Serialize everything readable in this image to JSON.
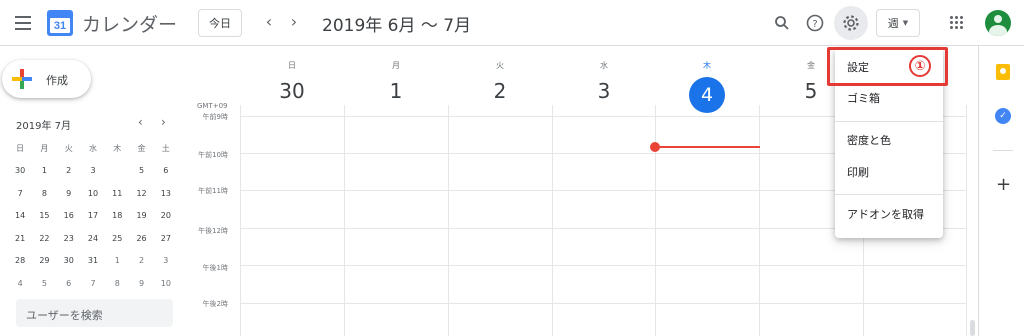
{
  "header": {
    "app_title": "カレンダー",
    "logo_day": "31",
    "today_button": "今日",
    "prev": "‹",
    "next": "›",
    "date_range": "2019年 6月 〜 7月",
    "view_select": "週",
    "icons": [
      "menu-icon",
      "search-icon",
      "help-icon",
      "settings-icon",
      "apps-icon",
      "account-icon"
    ]
  },
  "sidebar": {
    "create_label": "作成",
    "mini_calendar": {
      "title": "2019年 7月",
      "weekdays": [
        "日",
        "月",
        "火",
        "水",
        "木",
        "金",
        "土"
      ],
      "weeks": [
        [
          "30",
          "1",
          "2",
          "3",
          "4",
          "5",
          "6"
        ],
        [
          "7",
          "8",
          "9",
          "10",
          "11",
          "12",
          "13"
        ],
        [
          "14",
          "15",
          "16",
          "17",
          "18",
          "19",
          "20"
        ],
        [
          "21",
          "22",
          "23",
          "24",
          "25",
          "26",
          "27"
        ],
        [
          "28",
          "29",
          "30",
          "31",
          "1",
          "2",
          "3"
        ],
        [
          "4",
          "5",
          "6",
          "7",
          "8",
          "9",
          "10"
        ]
      ],
      "today": "4"
    },
    "search_users": "ユーザーを検索"
  },
  "grid": {
    "timezone": "GMT+09",
    "days": [
      {
        "name": "日",
        "num": "30"
      },
      {
        "name": "月",
        "num": "1"
      },
      {
        "name": "火",
        "num": "2"
      },
      {
        "name": "水",
        "num": "3"
      },
      {
        "name": "木",
        "num": "4"
      },
      {
        "name": "金",
        "num": "5"
      }
    ],
    "times": [
      "午前9時",
      "午前10時",
      "午前11時",
      "午後12時",
      "午後1時",
      "午後2時"
    ]
  },
  "settings_menu": {
    "items": [
      "設定",
      "ゴミ箱",
      "密度と色",
      "印刷",
      "アドオンを取得"
    ],
    "step_marker": "①"
  },
  "colors": {
    "accent": "#1a73e8",
    "now_line": "#ea4335",
    "highlight": "#e53935"
  }
}
